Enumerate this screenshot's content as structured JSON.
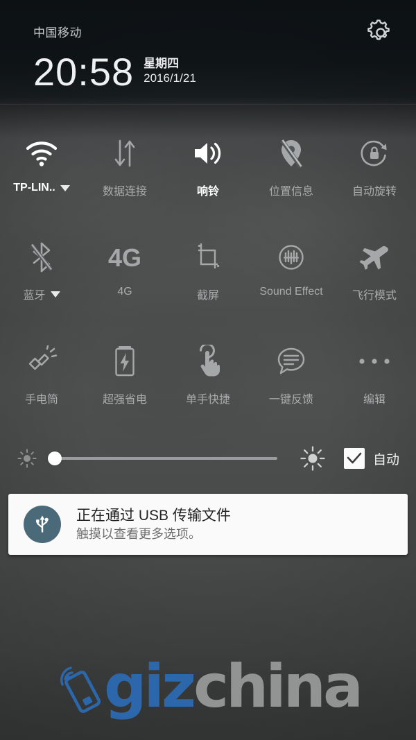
{
  "statusbar": {
    "carrier": "中国移动",
    "settings_icon": "gear-icon"
  },
  "clock": {
    "time": "20:58",
    "weekday": "星期四",
    "date": "2016/1/21"
  },
  "toggles": {
    "rows": [
      [
        {
          "label": "TP-LIN..",
          "icon": "wifi-icon",
          "active": true,
          "dropdown": true
        },
        {
          "label": "数据连接",
          "icon": "data-connection-icon",
          "active": false,
          "dropdown": false
        },
        {
          "label": "响铃",
          "icon": "ringer-volume-icon",
          "active": true,
          "dropdown": false
        },
        {
          "label": "位置信息",
          "icon": "location-off-icon",
          "active": false,
          "dropdown": false
        },
        {
          "label": "自动旋转",
          "icon": "auto-rotate-lock-icon",
          "active": false,
          "dropdown": false
        }
      ],
      [
        {
          "label": "蓝牙",
          "icon": "bluetooth-off-icon",
          "active": false,
          "dropdown": true
        },
        {
          "label": "4G",
          "icon": "4g-icon",
          "active": false,
          "dropdown": false
        },
        {
          "label": "截屏",
          "icon": "screenshot-crop-icon",
          "active": false,
          "dropdown": false
        },
        {
          "label": "Sound Effect",
          "icon": "sound-effect-icon",
          "active": false,
          "dropdown": false
        },
        {
          "label": "飞行模式",
          "icon": "airplane-icon",
          "active": false,
          "dropdown": false
        }
      ],
      [
        {
          "label": "手电筒",
          "icon": "flashlight-icon",
          "active": false,
          "dropdown": false
        },
        {
          "label": "超强省电",
          "icon": "battery-saver-icon",
          "active": false,
          "dropdown": false
        },
        {
          "label": "单手快捷",
          "icon": "one-hand-tap-icon",
          "active": false,
          "dropdown": false
        },
        {
          "label": "一键反馈",
          "icon": "feedback-bubble-icon",
          "active": false,
          "dropdown": false
        },
        {
          "label": "编辑",
          "icon": "more-dots-icon",
          "active": false,
          "dropdown": false
        }
      ]
    ]
  },
  "brightness": {
    "low_icon": "brightness-low-icon",
    "high_icon": "brightness-high-icon",
    "value_percent": 2,
    "auto_label": "自动",
    "auto_checked": true
  },
  "notification": {
    "icon": "usb-icon",
    "title": "正在通过 USB 传输文件",
    "subtitle": "触摸以查看更多选项。",
    "icon_color": "#4a6a7a"
  },
  "watermark": {
    "part1": "giz",
    "part2": "china",
    "color1": "#2c6bb5",
    "color2": "#9a9c9c"
  }
}
